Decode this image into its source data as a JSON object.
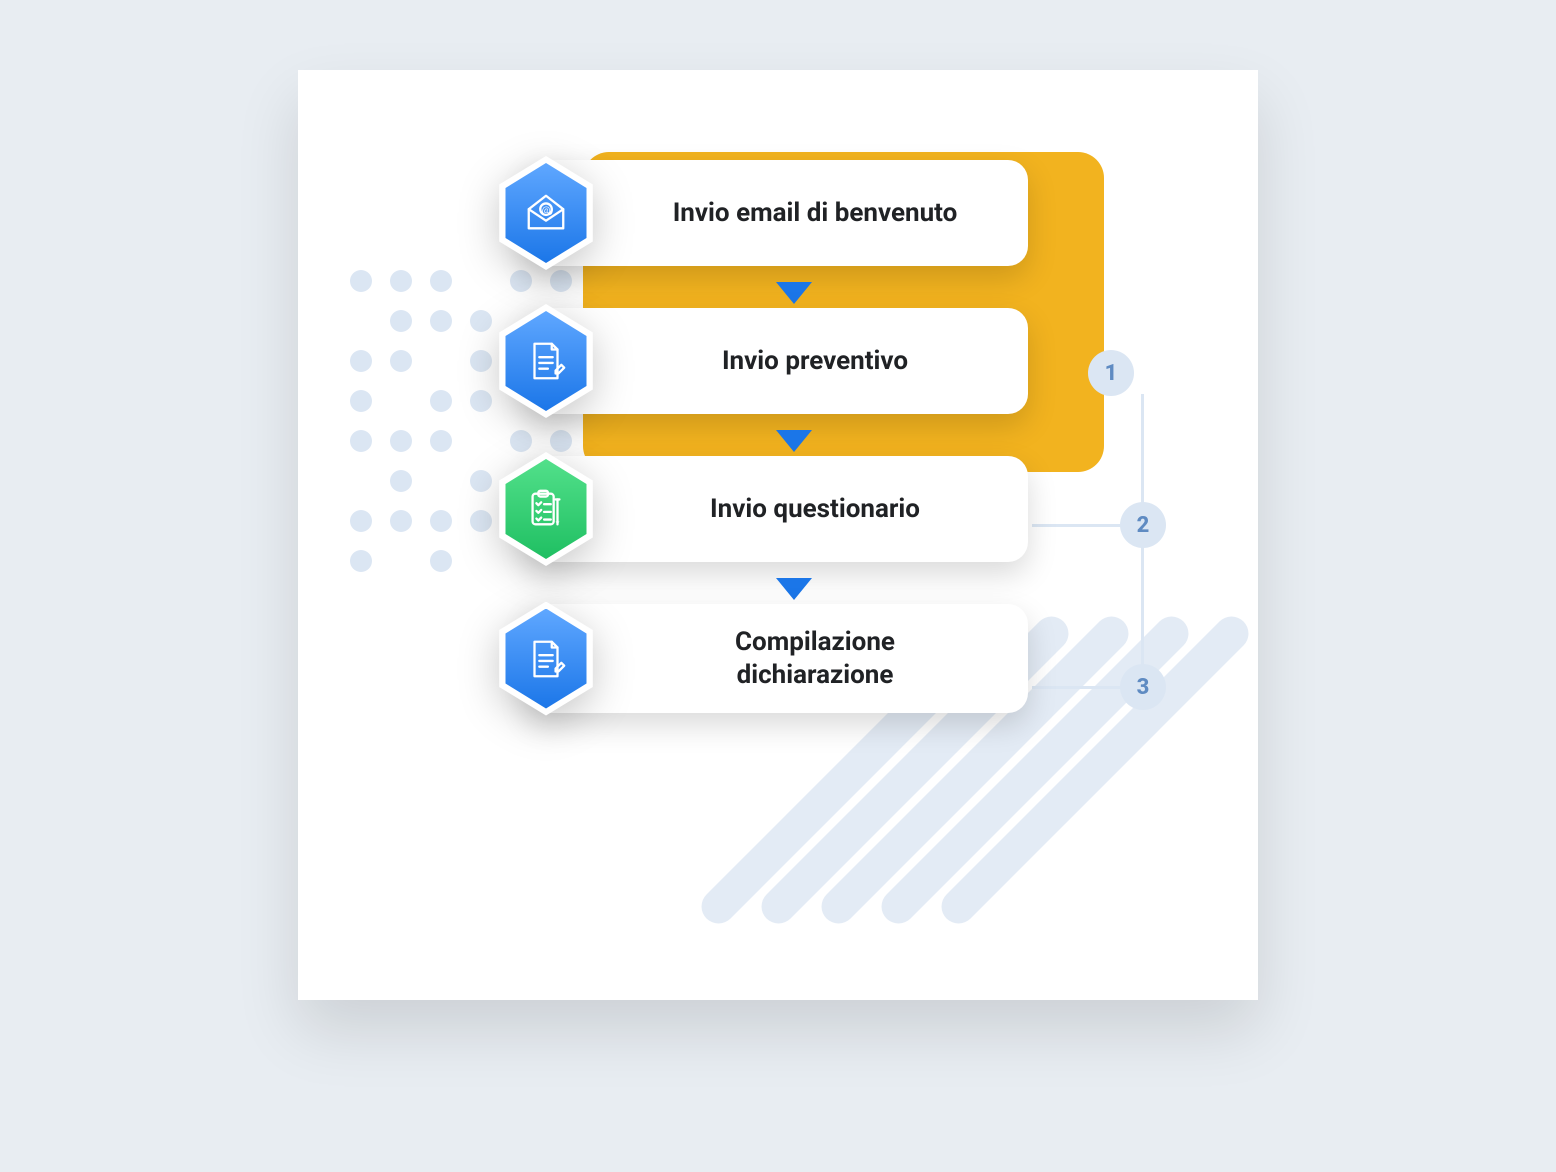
{
  "steps": [
    {
      "label": "Invio email di benvenuto",
      "color": "blue",
      "icon": "envelope-at-icon"
    },
    {
      "label": "Invio preventivo",
      "color": "blue",
      "icon": "document-edit-icon"
    },
    {
      "label": "Invio questionario",
      "color": "green",
      "icon": "checklist-icon"
    },
    {
      "label": "Compilazione dichiarazione",
      "color": "blue",
      "icon": "document-edit-icon"
    }
  ],
  "badges": {
    "b1": "1",
    "b2": "2",
    "b3": "3"
  }
}
